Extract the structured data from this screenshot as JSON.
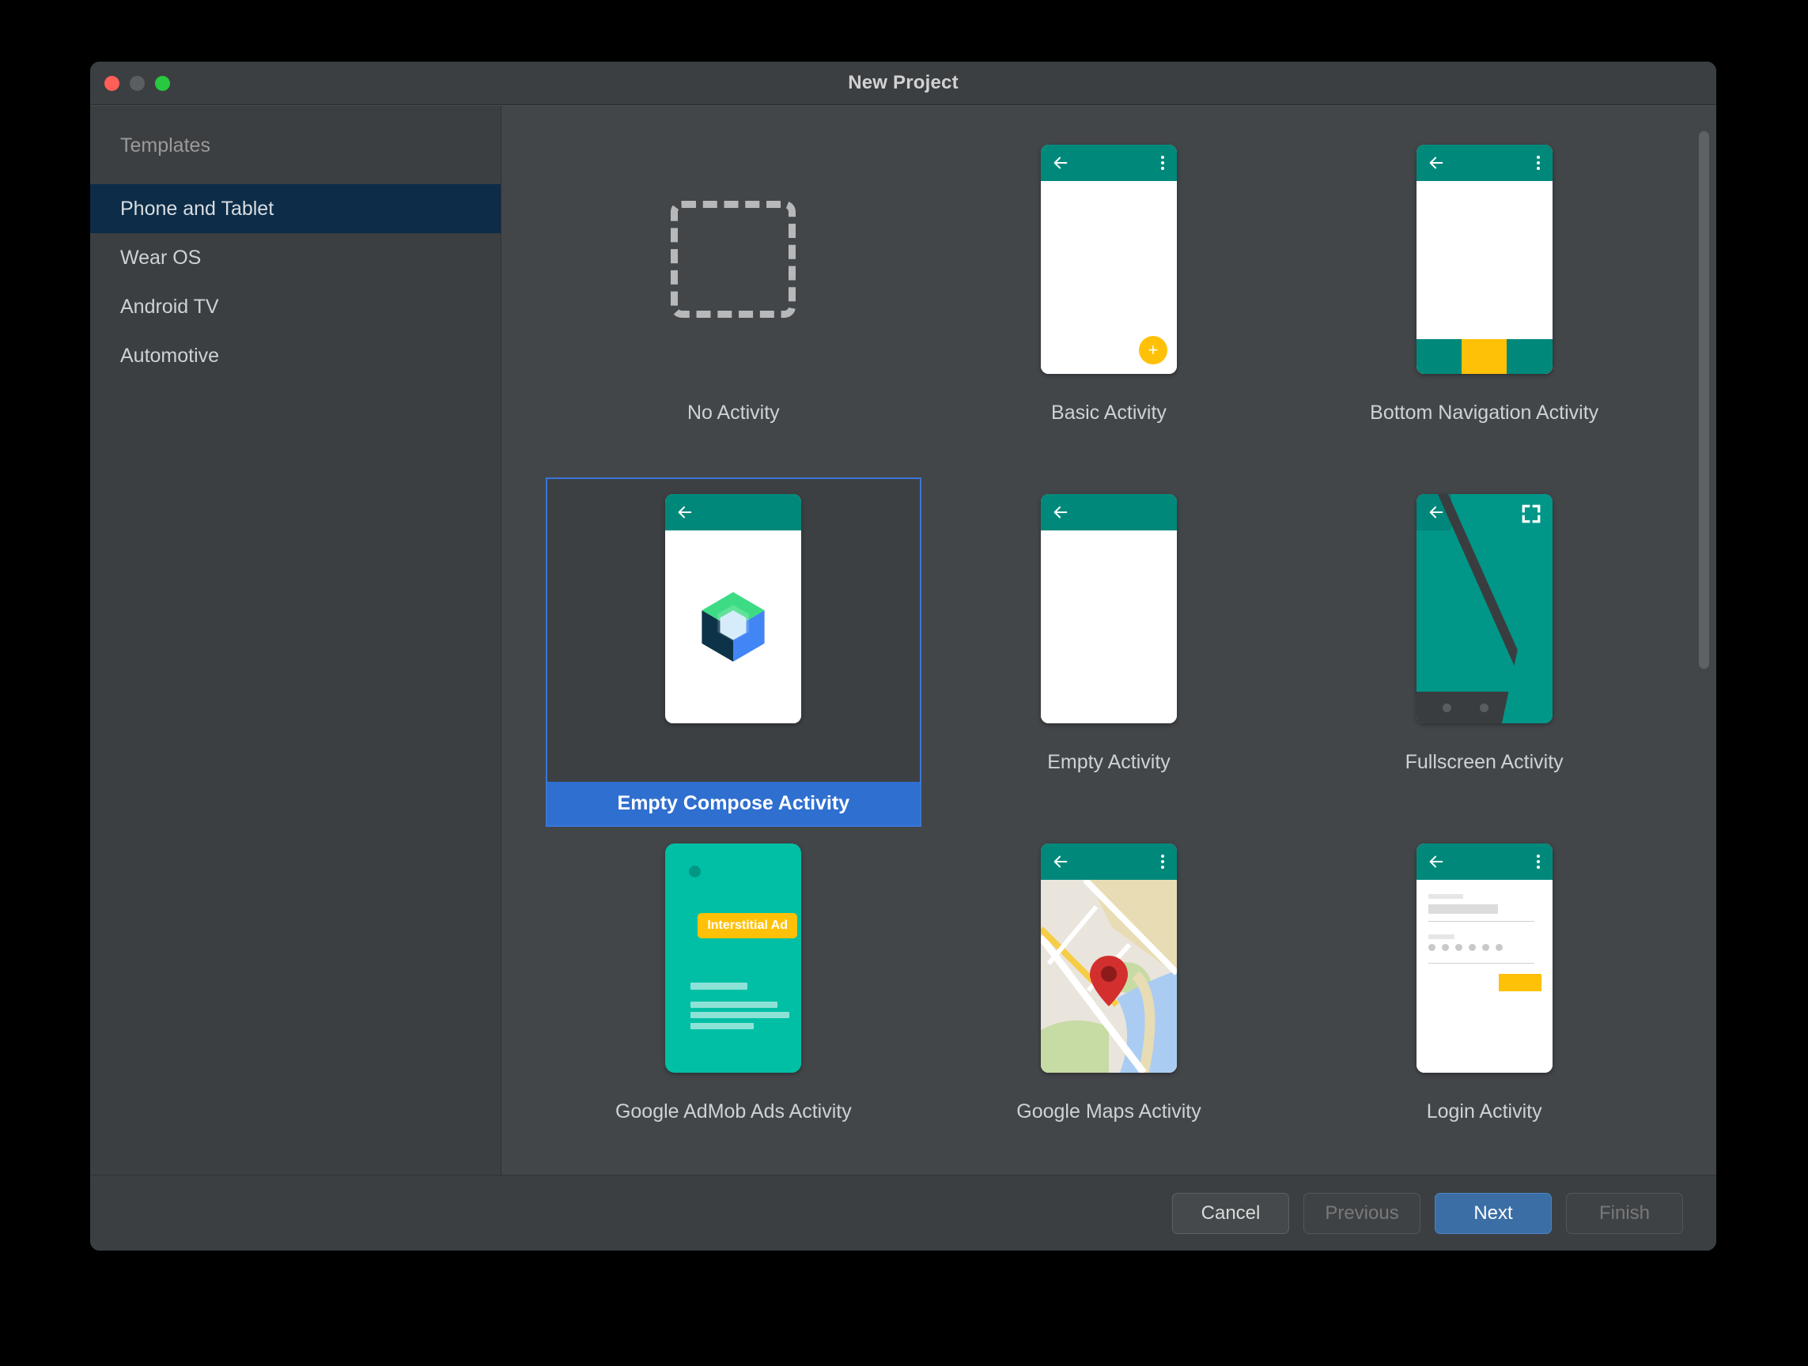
{
  "window": {
    "title": "New Project",
    "traffic_lights": [
      "close",
      "minimize",
      "maximize"
    ]
  },
  "sidebar": {
    "heading": "Templates",
    "items": [
      {
        "label": "Phone and Tablet",
        "selected": true
      },
      {
        "label": "Wear OS",
        "selected": false
      },
      {
        "label": "Android TV",
        "selected": false
      },
      {
        "label": "Automotive",
        "selected": false
      }
    ]
  },
  "templates": [
    {
      "label": "No Activity",
      "selected": false
    },
    {
      "label": "Basic Activity",
      "selected": false
    },
    {
      "label": "Bottom Navigation Activity",
      "selected": false
    },
    {
      "label": "Empty Compose Activity",
      "selected": true
    },
    {
      "label": "Empty Activity",
      "selected": false
    },
    {
      "label": "Fullscreen Activity",
      "selected": false
    },
    {
      "label": "Google AdMob Ads Activity",
      "selected": false
    },
    {
      "label": "Google Maps Activity",
      "selected": false
    },
    {
      "label": "Login Activity",
      "selected": false
    }
  ],
  "thumbnails": {
    "admob_badge": "Interstitial Ad",
    "fab_glyph": "+"
  },
  "footer": {
    "buttons": [
      {
        "label": "Cancel",
        "state": "enabled"
      },
      {
        "label": "Previous",
        "state": "disabled"
      },
      {
        "label": "Next",
        "state": "default"
      },
      {
        "label": "Finish",
        "state": "disabled"
      }
    ]
  },
  "colors": {
    "window_bg": "#3c3f41",
    "content_bg": "#434649",
    "sidebar_selected": "#0d2c47",
    "selection_blue": "#2f6fd0",
    "primary_button": "#3a6ea5",
    "teal": "#00897B",
    "teal_alt": "#009688",
    "teal_admob": "#00bfa5",
    "amber": "#FFC107",
    "map_pin": "#d32f2f"
  }
}
